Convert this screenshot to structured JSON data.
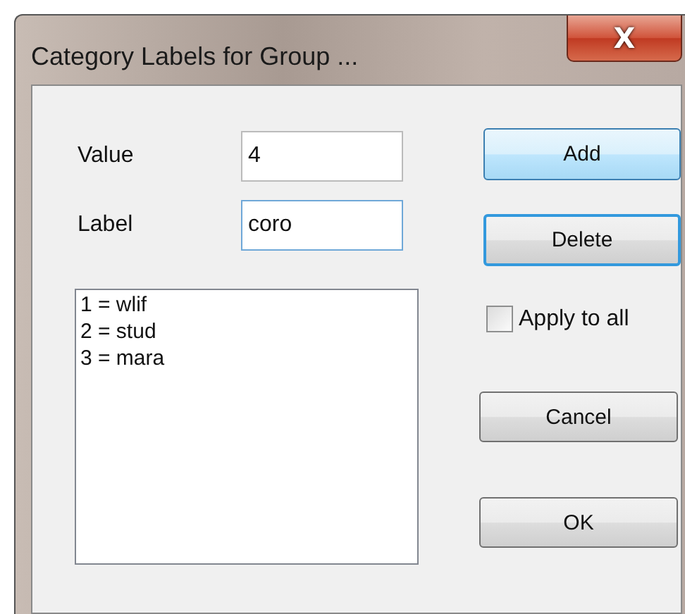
{
  "window": {
    "title": "Category Labels for Group ...",
    "close": "X"
  },
  "fields": [
    {
      "label": "Value",
      "value": "4",
      "focused": false
    },
    {
      "label": "Label",
      "value": "coro",
      "focused": true
    }
  ],
  "list": {
    "items": [
      "1 = wlif",
      "2 = stud",
      "3 = mara"
    ]
  },
  "buttons_top": [
    {
      "label": "Add",
      "hovered": true,
      "focused": false
    },
    {
      "label": "Delete",
      "hovered": false,
      "focused": true
    }
  ],
  "apply_to_all": {
    "label": "Apply to all",
    "checked": false
  },
  "buttons_bottom": [
    {
      "label": "Cancel",
      "hovered": false,
      "focused": false
    },
    {
      "label": "OK",
      "hovered": false,
      "focused": false
    }
  ]
}
